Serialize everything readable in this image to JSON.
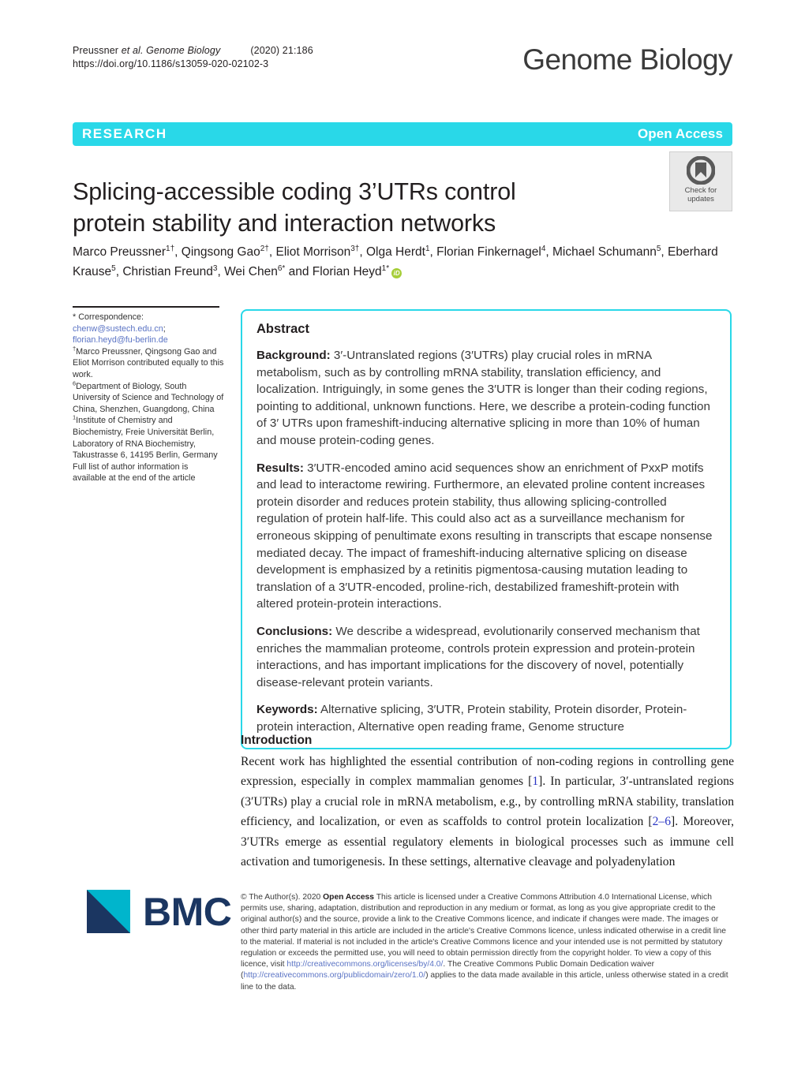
{
  "running_head": {
    "citation_author": "Preussner ",
    "citation_italic": "et al. Genome Biology",
    "volume": "(2020) 21:186",
    "doi": "https://doi.org/10.1186/s13059-020-02102-3"
  },
  "journal": {
    "name": "Genome Biology"
  },
  "bar": {
    "article_type": "RESEARCH",
    "access": "Open Access",
    "color": "#29d8e8"
  },
  "title": {
    "line1": "Splicing-accessible coding 3’UTRs control",
    "line2": "protein stability and interaction networks"
  },
  "crossmark": {
    "line1": "Check for",
    "line2": "updates"
  },
  "authors": {
    "list": [
      {
        "name": "Marco Preussner",
        "sup": "1†",
        "sep": ", "
      },
      {
        "name": "Qingsong Gao",
        "sup": "2†",
        "sep": ", "
      },
      {
        "name": "Eliot Morrison",
        "sup": "3†",
        "sep": ", "
      },
      {
        "name": "Olga Herdt",
        "sup": "1",
        "sep": ", "
      },
      {
        "name": "Florian Finkernagel",
        "sup": "4",
        "sep": ", "
      },
      {
        "name": "Michael Schumann",
        "sup": "5",
        "sep": ", "
      },
      {
        "name": "Eberhard Krause",
        "sup": "5",
        "sep": ", "
      },
      {
        "name": "Christian Freund",
        "sup": "3",
        "sep": ", "
      },
      {
        "name": "Wei Chen",
        "sup": "6*",
        "sep": " and "
      },
      {
        "name": "Florian Heyd",
        "sup": "1*",
        "sep": "",
        "orcid": true
      }
    ],
    "orcid_label": "iD"
  },
  "sidebar": {
    "correspondence_prefix": "* Correspondence: ",
    "email1": "chenw@sustech.edu.cn",
    "email_sep": "; ",
    "email2": "florian.heyd@fu-berlin.de",
    "equal_contrib": "Marco Preussner, Qingsong Gao and Eliot Morrison contributed equally to this work.",
    "equal_contrib_sup": "†",
    "aff6_sup": "6",
    "aff6": "Department of Biology, South University of Science and Technology of China, Shenzhen, Guangdong, China",
    "aff1_sup": "1",
    "aff1": "Institute of Chemistry and Biochemistry, Freie Universität Berlin, Laboratory of RNA Biochemistry, Takustrasse 6, 14195 Berlin, Germany",
    "full_list": "Full list of author information is available at the end of the article"
  },
  "abstract": {
    "heading": "Abstract",
    "background_label": "Background:",
    "background_text": " 3′-Untranslated regions (3′UTRs) play crucial roles in mRNA metabolism, such as by controlling mRNA stability, translation efficiency, and localization. Intriguingly, in some genes the 3′UTR is longer than their coding regions, pointing to additional, unknown functions. Here, we describe a protein-coding function of 3′ UTRs upon frameshift-inducing alternative splicing in more than 10% of human and mouse protein-coding genes.",
    "results_label": "Results:",
    "results_text": " 3′UTR-encoded amino acid sequences show an enrichment of PxxP motifs and lead to interactome rewiring. Furthermore, an elevated proline content increases protein disorder and reduces protein stability, thus allowing splicing-controlled regulation of protein half-life. This could also act as a surveillance mechanism for erroneous skipping of penultimate exons resulting in transcripts that escape nonsense mediated decay. The impact of frameshift-inducing alternative splicing on disease development is emphasized by a retinitis pigmentosa-causing mutation leading to translation of a 3′UTR-encoded, proline-rich, destabilized frameshift-protein with altered protein-protein interactions.",
    "conclusions_label": "Conclusions:",
    "conclusions_text": " We describe a widespread, evolutionarily conserved mechanism that enriches the mammalian proteome, controls protein expression and protein-protein interactions, and has important implications for the discovery of novel, potentially disease-relevant protein variants.",
    "keywords_label": "Keywords:",
    "keywords_text": " Alternative splicing, 3′UTR, Protein stability, Protein disorder, Protein-protein interaction, Alternative open reading frame, Genome structure"
  },
  "introduction": {
    "heading": "Introduction",
    "part1": "Recent work has highlighted the essential contribution of non-coding regions in controlling gene expression, especially in complex mammalian genomes [",
    "ref1": "1",
    "part2": "]. In particular, 3′-untranslated regions (3′UTRs) play a crucial role in mRNA metabolism, e.g., by controlling mRNA stability, translation efficiency, and localization, or even as scaffolds to control protein localization [",
    "ref2": "2–6",
    "part3": "]. Moreover, 3′UTRs emerge as essential regulatory elements in biological processes such as immune cell activation and tumorigenesis. In these settings, alternative cleavage and polyadenylation"
  },
  "publisher": {
    "name": "BMC",
    "mark_dark": "#1b3661",
    "mark_cyan": "#00b5cc"
  },
  "license": {
    "copyright": "© The Author(s). 2020 ",
    "open_access": "Open Access",
    "text1": " This article is licensed under a Creative Commons Attribution 4.0 International License, which permits use, sharing, adaptation, distribution and reproduction in any medium or format, as long as you give appropriate credit to the original author(s) and the source, provide a link to the Creative Commons licence, and indicate if changes were made. The images or other third party material in this article are included in the article's Creative Commons licence, unless indicated otherwise in a credit line to the material. If material is not included in the article's Creative Commons licence and your intended use is not permitted by statutory regulation or exceeds the permitted use, you will need to obtain permission directly from the copyright holder. To view a copy of this licence, visit ",
    "link1": "http://creativecommons.org/licenses/by/4.0/",
    "text2": ". The Creative Commons Public Domain Dedication waiver (",
    "link2": "http://creativecommons.org/publicdomain/zero/1.0/",
    "text3": ") applies to the data made available in this article, unless otherwise stated in a credit line to the data."
  }
}
